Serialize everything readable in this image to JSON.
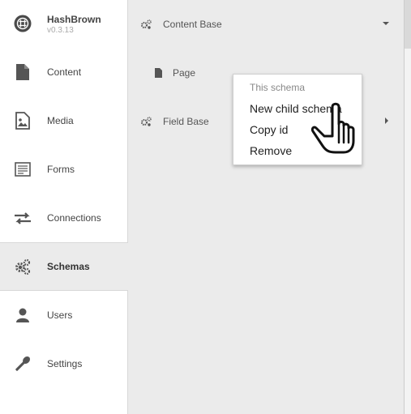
{
  "brand": {
    "name": "HashBrown",
    "version": "v0.3.13"
  },
  "sidebar": {
    "items": [
      {
        "label": "Content",
        "icon": "file-icon"
      },
      {
        "label": "Media",
        "icon": "image-icon"
      },
      {
        "label": "Forms",
        "icon": "form-icon"
      },
      {
        "label": "Connections",
        "icon": "exchange-icon"
      },
      {
        "label": "Schemas",
        "icon": "cogs-icon",
        "active": true
      },
      {
        "label": "Users",
        "icon": "user-icon"
      },
      {
        "label": "Settings",
        "icon": "wrench-icon"
      }
    ]
  },
  "tree": {
    "items": [
      {
        "label": "Content Base",
        "icon": "cogs-icon",
        "expanded": true
      },
      {
        "label": "Page",
        "icon": "file-icon"
      },
      {
        "label": "Field Base",
        "icon": "cogs-icon",
        "expanded": false
      }
    ]
  },
  "context_menu": {
    "heading": "This schema",
    "items": [
      {
        "label": "New child schema"
      },
      {
        "label": "Copy id"
      },
      {
        "label": "Remove"
      }
    ]
  },
  "colors": {
    "background": "#ebebeb",
    "sidebar": "#ffffff",
    "icon": "#555555"
  }
}
